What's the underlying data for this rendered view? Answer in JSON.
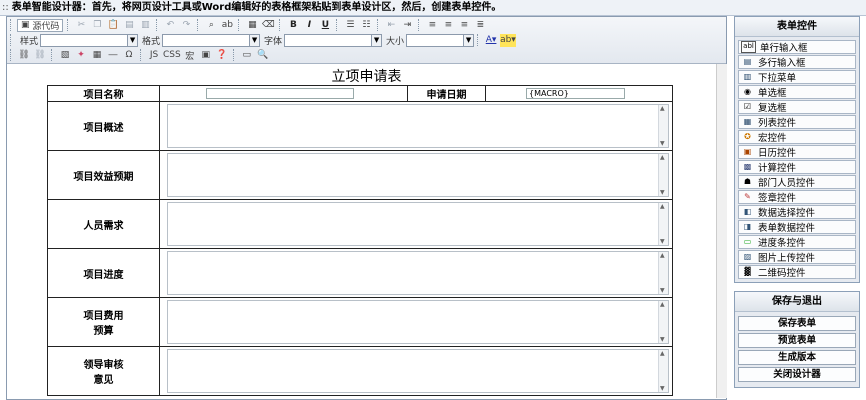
{
  "topbar": {
    "grip": "::",
    "text": "表单智能设计器：首先，将网页设计工具或Word编辑好的表格框架粘贴到表单设计区，然后，创建表单控件。"
  },
  "toolbar": {
    "source_label": "源代码",
    "style_label": "样式",
    "format_label": "格式",
    "font_label": "字体",
    "size_label": "大小",
    "js_label": "JS",
    "css_label": "CSS",
    "macro_label": "宏"
  },
  "document": {
    "title": "立项申请表",
    "name_label": "项目名称",
    "date_label": "申请日期",
    "date_value": "{MACRO}",
    "rows": [
      {
        "label": "项目概述"
      },
      {
        "label": "项目效益预期"
      },
      {
        "label": "人员需求"
      },
      {
        "label": "项目进度"
      },
      {
        "label_line1": "项目费用",
        "label_line2": "预算"
      },
      {
        "label_line1": "领导审核",
        "label_line2": "意见"
      }
    ]
  },
  "controls_panel": {
    "title": "表单控件",
    "items": [
      {
        "label": "单行输入框",
        "icon": "text-field-icon"
      },
      {
        "label": "多行输入框",
        "icon": "textarea-icon"
      },
      {
        "label": "下拉菜单",
        "icon": "dropdown-icon"
      },
      {
        "label": "单选框",
        "icon": "radio-icon"
      },
      {
        "label": "复选框",
        "icon": "checkbox-icon"
      },
      {
        "label": "列表控件",
        "icon": "list-icon"
      },
      {
        "label": "宏控件",
        "icon": "macro-icon"
      },
      {
        "label": "日历控件",
        "icon": "calendar-icon"
      },
      {
        "label": "计算控件",
        "icon": "calculator-icon"
      },
      {
        "label": "部门人员控件",
        "icon": "users-icon"
      },
      {
        "label": "签章控件",
        "icon": "stamp-icon"
      },
      {
        "label": "数据选择控件",
        "icon": "data-select-icon"
      },
      {
        "label": "表单数据控件",
        "icon": "form-data-icon"
      },
      {
        "label": "进度条控件",
        "icon": "progress-icon"
      },
      {
        "label": "图片上传控件",
        "icon": "image-upload-icon"
      },
      {
        "label": "二维码控件",
        "icon": "qrcode-icon"
      }
    ]
  },
  "save_panel": {
    "title": "保存与退出",
    "save": "保存表单",
    "preview": "预览表单",
    "version": "生成版本",
    "close": "关闭设计器"
  }
}
